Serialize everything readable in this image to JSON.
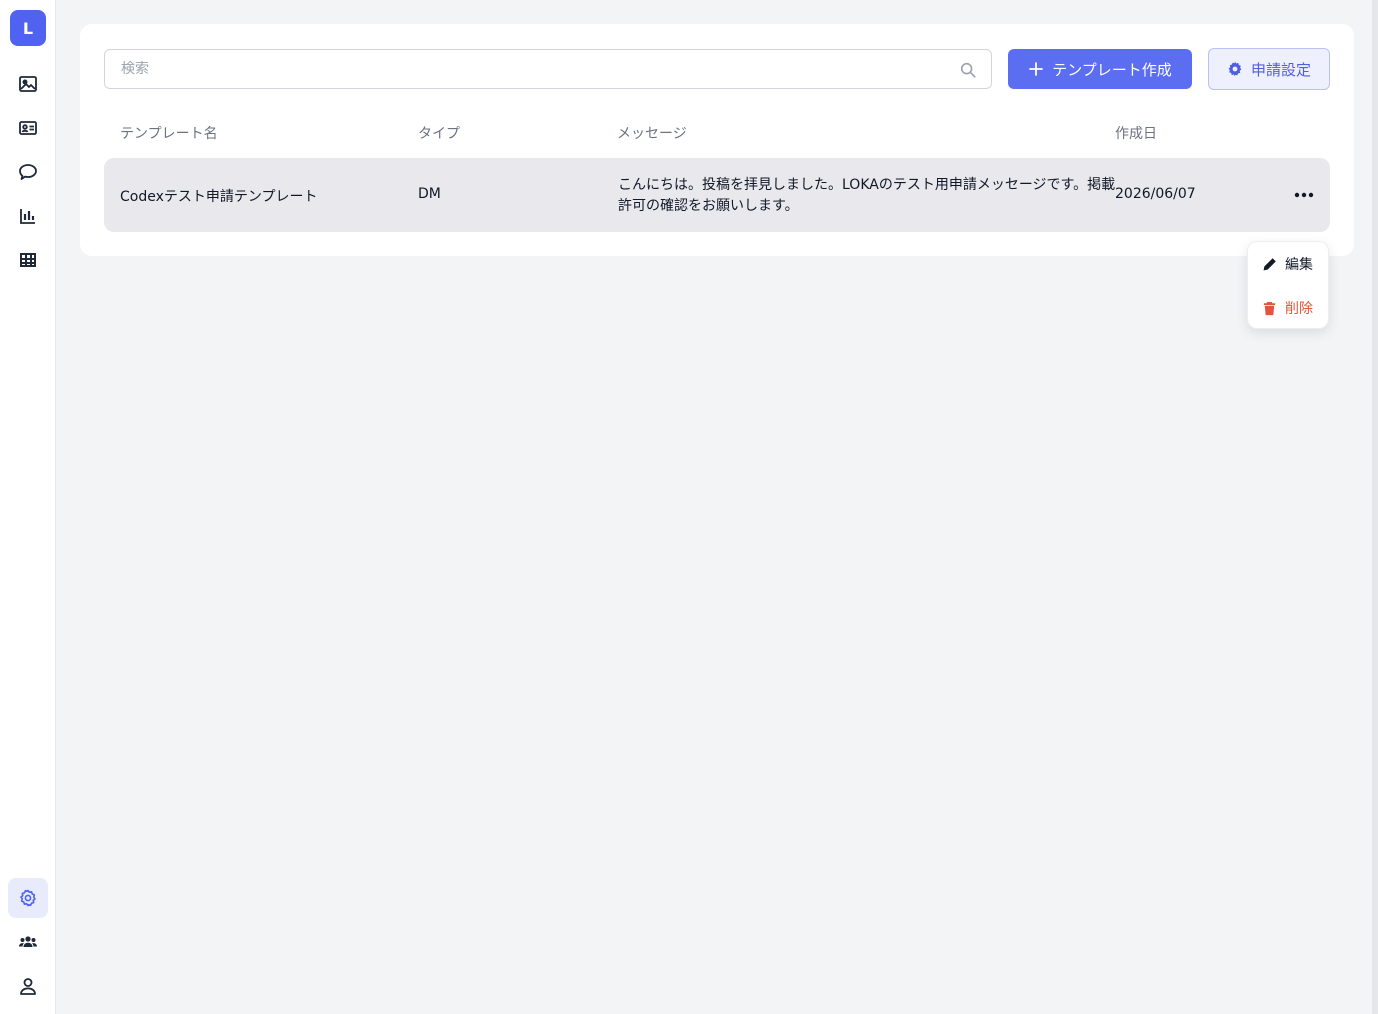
{
  "sidebar": {
    "logo": "L",
    "top_items": [
      {
        "icon": "image-icon"
      },
      {
        "icon": "id-card-icon"
      },
      {
        "icon": "chat-bubble-icon"
      },
      {
        "icon": "bar-chart-icon"
      },
      {
        "icon": "table-icon"
      }
    ],
    "bottom_items": [
      {
        "icon": "gear-icon",
        "active": true
      },
      {
        "icon": "users-icon"
      },
      {
        "icon": "user-icon"
      }
    ]
  },
  "toolbar": {
    "search_placeholder": "検索",
    "create_label": "テンプレート作成",
    "settings_label": "申請設定"
  },
  "table": {
    "columns": [
      "テンプレート名",
      "タイプ",
      "メッセージ",
      "作成日"
    ],
    "rows": [
      {
        "name": "Codexテスト申請テンプレート",
        "type": "DM",
        "message": "こんにちは。投稿を拝見しました。LOKAのテスト用申請メッセージです。掲載許可の確認をお願いします。",
        "date": "2026/06/07"
      }
    ]
  },
  "row_menu": {
    "edit_label": "編集",
    "delete_label": "削除"
  },
  "colors": {
    "accent": "#5b6ef1",
    "danger": "#e5533d",
    "row_bg": "#e8e8ed"
  }
}
